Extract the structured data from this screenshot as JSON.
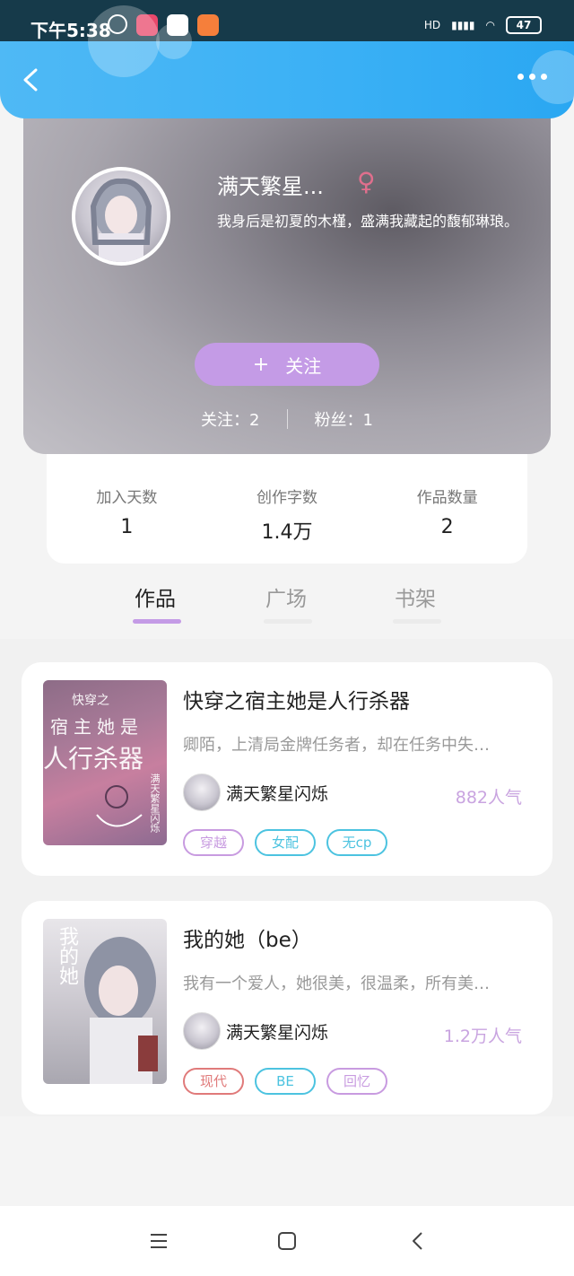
{
  "status_bar": {
    "time": "下午5:38",
    "battery": "47",
    "signal_label": "HD"
  },
  "nav": {
    "back_icon": "chevron-left-icon",
    "more_icon": "more-dots-icon"
  },
  "profile": {
    "name": "满天繁星...",
    "gender_symbol": "♀",
    "bio": "我身后是初夏的木槿，盛满我藏起的馥郁琳琅。",
    "follow_button": {
      "plus": "+",
      "label": "关注"
    },
    "following": "关注：2",
    "fans": "粉丝：1"
  },
  "stats": [
    {
      "label": "加入天数",
      "value": "1"
    },
    {
      "label": "创作字数",
      "value": "1.4万"
    },
    {
      "label": "作品数量",
      "value": "2"
    }
  ],
  "tabs": [
    {
      "label": "作品",
      "active": true
    },
    {
      "label": "广场",
      "active": false
    },
    {
      "label": "书架",
      "active": false
    }
  ],
  "works": [
    {
      "title": "快穿之宿主她是人行杀器",
      "description": "卿陌，上清局金牌任务者，却在任务中失…",
      "author": "满天繁星闪烁",
      "popularity": "882人气",
      "tags": [
        {
          "label": "穿越",
          "color": "#c89be0"
        },
        {
          "label": "女配",
          "color": "#4cc3e0"
        },
        {
          "label": "无cp",
          "color": "#4cc3e0"
        }
      ],
      "cover_text": {
        "line1": "快穿之",
        "line2": "宿主她是",
        "line3": "人行杀器",
        "side": "满天繁星闪烁"
      }
    },
    {
      "title": "我的她（be）",
      "description": "我有一个爱人，她很美，很温柔，所有美…",
      "author": "满天繁星闪烁",
      "popularity": "1.2万人气",
      "tags": [
        {
          "label": "现代",
          "color": "#e07a7a"
        },
        {
          "label": "BE",
          "color": "#4cc3e0"
        },
        {
          "label": "回忆",
          "color": "#c89be0"
        }
      ],
      "cover_text": {
        "line1": "我的她"
      }
    }
  ],
  "colors": {
    "accent_purple": "#c49be6",
    "nav_blue": "#3ab0f5",
    "tab_underline_active": "#c49be6"
  }
}
